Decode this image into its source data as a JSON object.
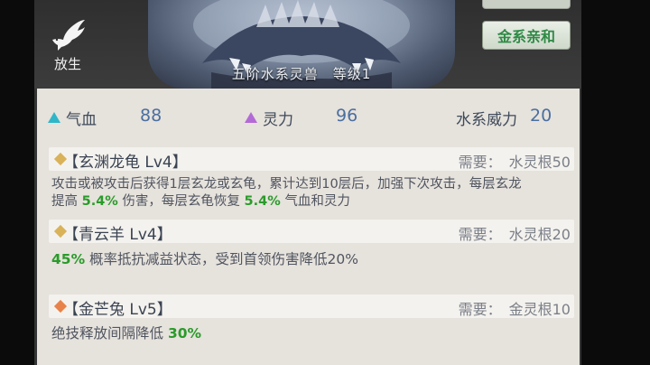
{
  "beast": {
    "caption": "五阶水系灵兽　等级1"
  },
  "release": {
    "label": "放生",
    "icon": "dove-icon"
  },
  "affinity_button": {
    "label": "金系亲和",
    "color": "#2f8a46"
  },
  "stats": [
    {
      "label": "气血",
      "value": "88",
      "icon": "triangle-cyan-icon",
      "color": "#2fb6c8"
    },
    {
      "label": "灵力",
      "value": "96",
      "icon": "triangle-purple-icon",
      "color": "#b36ad6"
    },
    {
      "label": "水系威力",
      "value": "20"
    }
  ],
  "skills": [
    {
      "name": "【玄渊龙龟 Lv4】",
      "requirement": "需要：　水灵根50",
      "diamond_color": "#d9b25a",
      "desc_line1": "攻击或被攻击后获得1层玄龙或玄龟，累计达到10层后，加强下次攻击，每层玄龙",
      "desc_line2_pre": "提高 ",
      "desc_line2_hl1": "5.4%",
      "desc_line2_mid": " 伤害，每层玄龟恢复 ",
      "desc_line2_hl2": "5.4%",
      "desc_line2_post": " 气血和灵力"
    },
    {
      "name": "【青云羊 Lv4】",
      "requirement": "需要：　水灵根20",
      "diamond_color": "#d9b25a",
      "desc_hl": "45%",
      "desc_post": " 概率抵抗减益状态，受到首领伤害降低20%"
    },
    {
      "name": "【金芒兔 Lv5】",
      "requirement": "需要：　金灵根10",
      "diamond_color": "#e8824a",
      "desc_pre": "绝技释放间隔降低 ",
      "desc_hl": "30%"
    }
  ]
}
